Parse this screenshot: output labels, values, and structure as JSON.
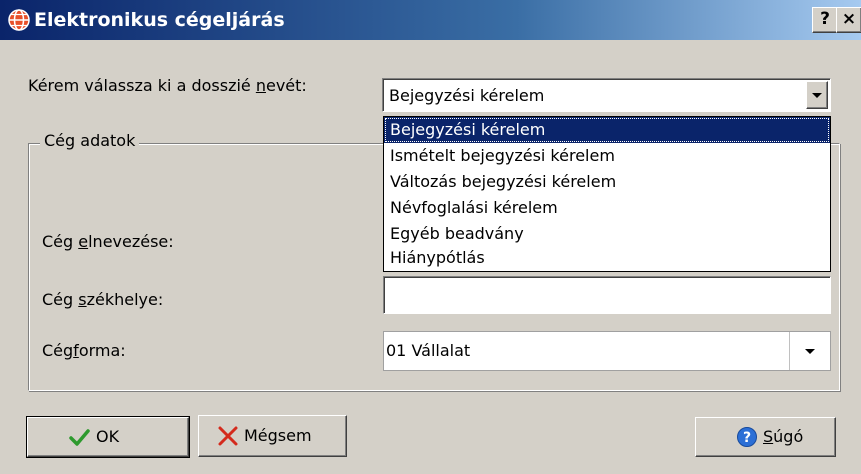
{
  "window": {
    "title": "Elektronikus cégeljárás",
    "help_btn": "?",
    "close_btn": "×"
  },
  "form": {
    "dossier_label_pre": "Kérem válassza ki a dosszié ",
    "dossier_label_u": "n",
    "dossier_label_post": "evét:",
    "dossier_value": "Bejegyzési kérelem",
    "group_title": "Cég adatok",
    "name_label_pre": "Cég ",
    "name_label_u": "e",
    "name_label_post": "lnevezése:",
    "seat_label_pre": "Cég ",
    "seat_label_u": "s",
    "seat_label_post": "zékhelye:",
    "seat_value": "",
    "form_label_pre": "Cég",
    "form_label_u": "f",
    "form_label_post": "orma:",
    "form_value": "01 Vállalat"
  },
  "dropdown": {
    "options": [
      "Bejegyzési kérelem",
      "Ismételt bejegyzési kérelem",
      "Változás bejegyzési kérelem",
      "Névfoglalási kérelem",
      "Egyéb beadvány",
      "Hiánypótlás"
    ],
    "selected_index": 0
  },
  "buttons": {
    "ok_label": "OK",
    "cancel_label": "Mégsem",
    "help_label_u": "S",
    "help_label_post": "úgó"
  },
  "icons": {
    "app": "globe-icon",
    "ok": "checkmark-icon",
    "cancel": "red-x-icon",
    "help": "question-icon"
  },
  "colors": {
    "titlebar_start": "#0a246a",
    "titlebar_end": "#a6caf0",
    "selection": "#0a246a",
    "face": "#d4d0c8"
  }
}
